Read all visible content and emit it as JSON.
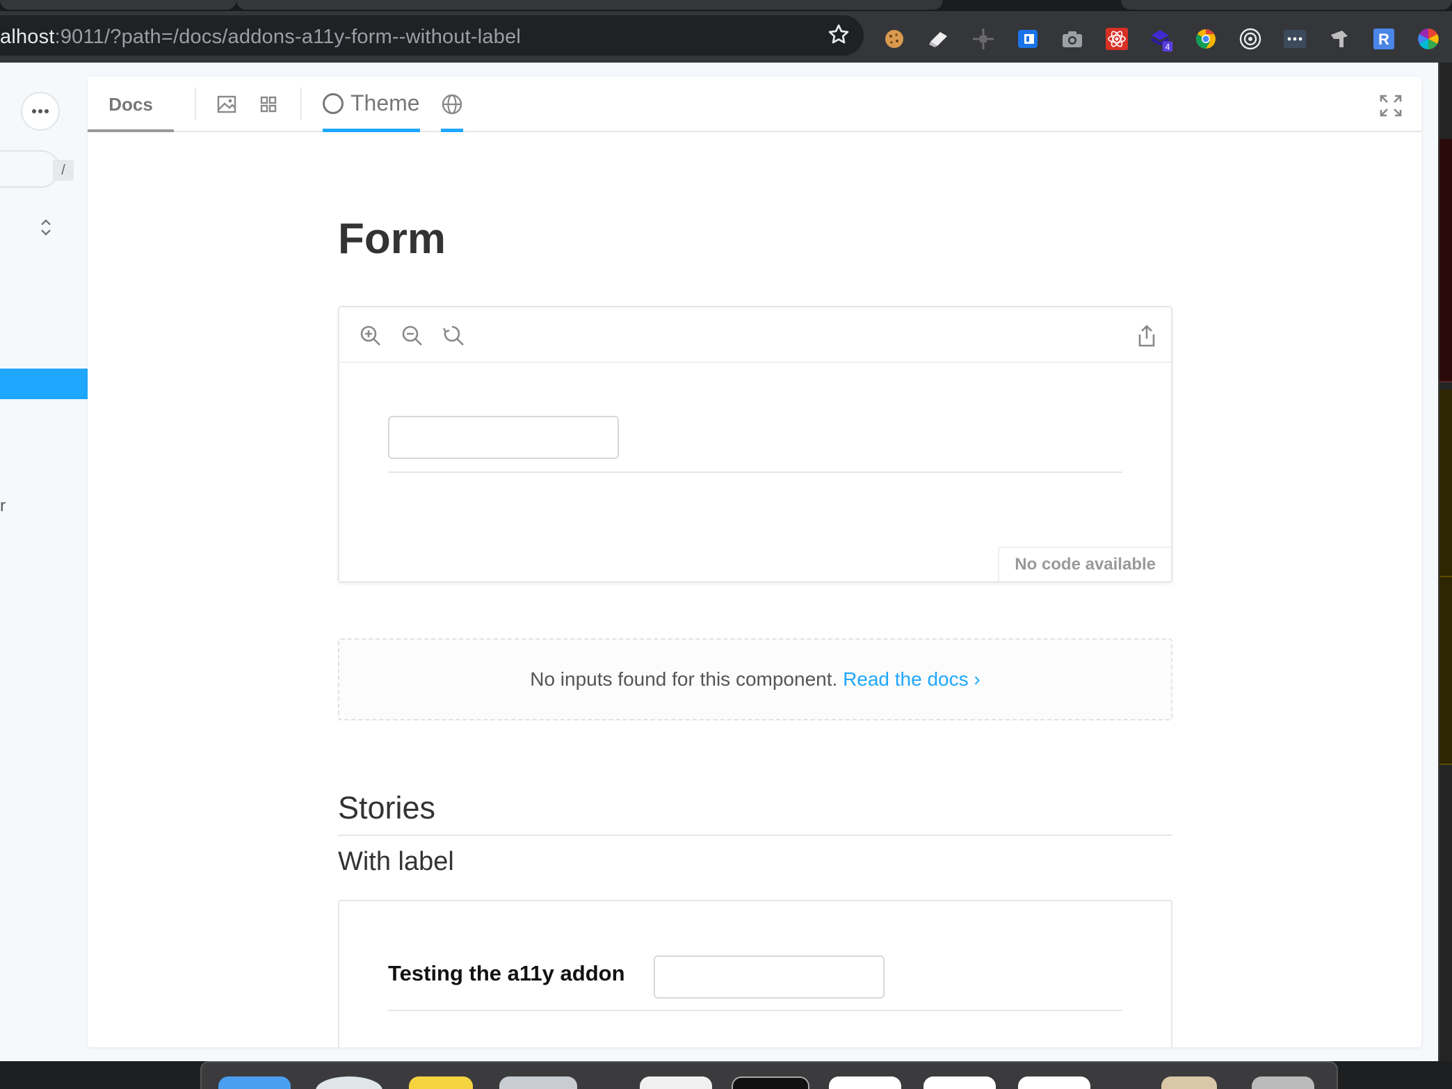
{
  "browser": {
    "url_host": "alhost",
    "url_rest": ":9011/?path=/docs/addons-a11y-form--without-label",
    "extensions": [
      "cookie-icon",
      "eraser-icon",
      "move-icon",
      "screen-reader-icon",
      "camera-icon",
      "react-devtools-icon",
      "layers-icon",
      "chrome-icon",
      "target-icon",
      "dots-icon",
      "pin-icon",
      "r-icon",
      "color-wheel-icon"
    ],
    "extension_badge": "4",
    "r_letter": "R"
  },
  "sidebar": {
    "search_shortcut": "/",
    "fragment_text": "r"
  },
  "panel": {
    "docs_tab": "Docs",
    "theme_label": "Theme"
  },
  "doc": {
    "title": "Form",
    "no_code": "No code available",
    "args_text": "No inputs found for this component.",
    "args_link": "Read the docs",
    "args_chevron": "›",
    "stories_heading": "Stories",
    "story_name": "With label",
    "story_label": "Testing the a11y addon"
  },
  "colors": {
    "accent": "#1ea7fd",
    "chrome_bg": "#35363a"
  }
}
